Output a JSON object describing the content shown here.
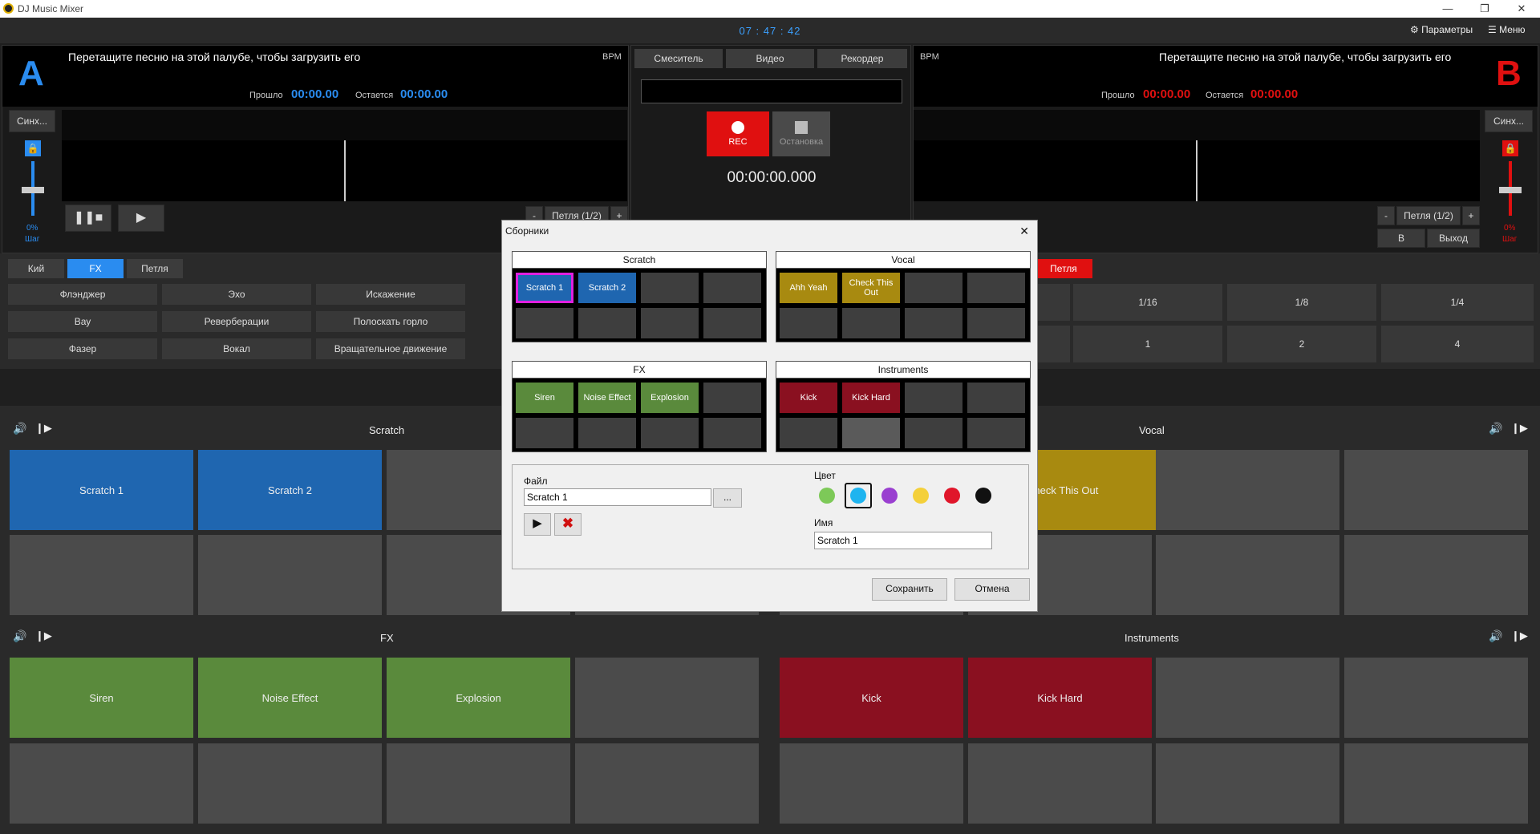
{
  "window": {
    "title": "DJ Music Mixer",
    "minimize": "—",
    "maximize": "❐",
    "close": "✕"
  },
  "topbar": {
    "clock": "07 : 47 : 42",
    "settings_label": "Параметры",
    "menu_label": "Меню"
  },
  "deck_a": {
    "letter": "A",
    "prompt": "Перетащите песню на этой палубе, чтобы загрузить его",
    "bpm_label": "BPM",
    "elapsed_label": "Прошло",
    "elapsed_value": "00:00.00",
    "remaining_label": "Остается",
    "remaining_value": "00:00.00",
    "sync_label": "Синх...",
    "pitch_value": "0%",
    "step_label": "Шаг",
    "loop_label": "Петля (1/2)",
    "loop_minus": "-",
    "loop_plus": "+",
    "accent": "#2a8cf0"
  },
  "deck_b": {
    "letter": "B",
    "prompt": "Перетащите песню на этой палубе, чтобы загрузить его",
    "bpm_label": "BPM",
    "elapsed_label": "Прошло",
    "elapsed_value": "00:00.00",
    "remaining_label": "Остается",
    "remaining_value": "00:00.00",
    "sync_label": "Синх...",
    "pitch_value": "0%",
    "step_label": "Шаг",
    "loop_label": "Петля (1/2)",
    "loop_minus": "-",
    "loop_plus": "+",
    "in_label": "В",
    "out_label": "Выход",
    "accent": "#e01010"
  },
  "center": {
    "tabs": [
      "Смеситель",
      "Видео",
      "Рекордер"
    ],
    "rec_label": "REC",
    "stop_label": "Остановка",
    "timer": "00:00:00.000"
  },
  "effects_a": {
    "tabs": [
      "Кий",
      "FX",
      "Петля"
    ],
    "active_tab": "FX",
    "buttons": [
      "Флэнджер",
      "Эхо",
      "Искажение",
      "Вау",
      "Реверберации",
      "Полоскать горло",
      "Фазер",
      "Вокал",
      "Вращательное движение"
    ]
  },
  "effects_b": {
    "loop_tab": "Петля",
    "buttons": [
      "1/16",
      "1/8",
      "1/4",
      "1",
      "2",
      "4"
    ]
  },
  "banks": [
    {
      "title": "Scratch",
      "pads": [
        "Scratch 1",
        "Scratch 2",
        "",
        "",
        "",
        "",
        "",
        ""
      ]
    },
    {
      "title": "Vocal",
      "pads": [
        "Check This Out",
        "",
        "",
        "",
        "",
        "",
        "",
        ""
      ]
    },
    {
      "title": "FX",
      "pads": [
        "Siren",
        "Noise Effect",
        "Explosion",
        "",
        "",
        "",
        "",
        ""
      ]
    },
    {
      "title": "Instruments",
      "pads": [
        "Kick",
        "Kick Hard",
        "",
        "",
        "",
        "",
        "",
        ""
      ]
    }
  ],
  "dialog": {
    "title": "Сборники",
    "close": "✕",
    "groups": [
      {
        "title": "Scratch",
        "pads": [
          "Scratch 1",
          "Scratch 2",
          "",
          "",
          "",
          "",
          "",
          ""
        ]
      },
      {
        "title": "Vocal",
        "pads": [
          "Ahh Yeah",
          "Check This Out",
          "",
          "",
          "",
          "",
          "",
          ""
        ]
      },
      {
        "title": "FX",
        "pads": [
          "Siren",
          "Noise Effect",
          "Explosion",
          "",
          "",
          "",
          "",
          ""
        ]
      },
      {
        "title": "Instruments",
        "pads": [
          "Kick",
          "Kick Hard",
          "",
          "",
          "",
          "",
          "",
          ""
        ]
      }
    ],
    "file_label": "Файл",
    "file_value": "Scratch 1",
    "browse": "...",
    "color_label": "Цвет",
    "name_label": "Имя",
    "name_value": "Scratch 1",
    "save": "Сохранить",
    "cancel": "Отмена",
    "swatches": [
      "#7dc958",
      "#1fb4ef",
      "#9a3fd0",
      "#f4d03a",
      "#e0162a",
      "#111111"
    ]
  },
  "colors": {
    "scratch": "#1f66b0",
    "vocal": "#a88a10",
    "fx": "#5a8a3c",
    "instruments": "#8a1020",
    "selected_border": "#e020e0"
  }
}
